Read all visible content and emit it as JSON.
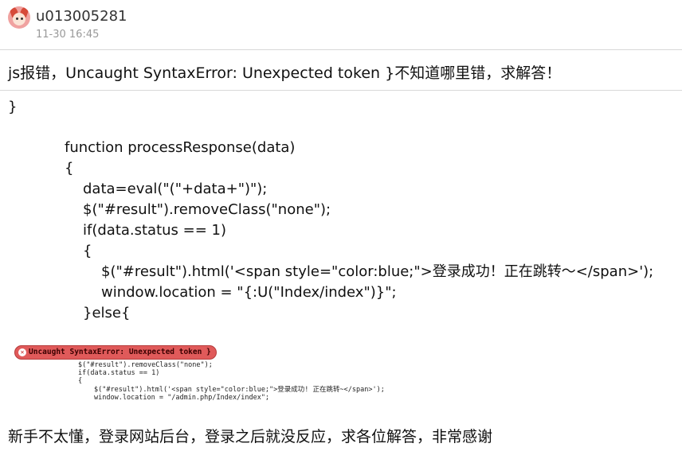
{
  "post": {
    "author": "u013005281",
    "time": "11-30 16:45",
    "title": "js报错，Uncaught SyntaxError: Unexpected token }不知道哪里错，求解答！",
    "code_lines": [
      "}",
      "function processResponse(data)",
      "{",
      "data=eval(\"(\"+data+\")\");",
      "$(\"#result\").removeClass(\"none\");",
      "if(data.status == 1)",
      "{",
      "$(\"#result\").html('<span style=\"color:blue;\">登录成功！正在跳转～</span>');",
      "window.location = \"{:U(\"Index/index\")}\";",
      "}else{"
    ],
    "screenshot": {
      "error": "Uncaught SyntaxError: Unexpected token }",
      "error_icon": "error-icon",
      "lines": [
        "$(\"#result\").removeClass(\"none\");",
        "if(data.status == 1)",
        "{",
        "$(\"#result\").html('<span style=\"color:blue;\">登录成功! 正在跳转~</span>');",
        "window.location = \"/admin.php/Index/index\";"
      ]
    },
    "footer": "新手不太懂，登录网站后台，登录之后就没反应，求各位解答，非常感谢"
  }
}
